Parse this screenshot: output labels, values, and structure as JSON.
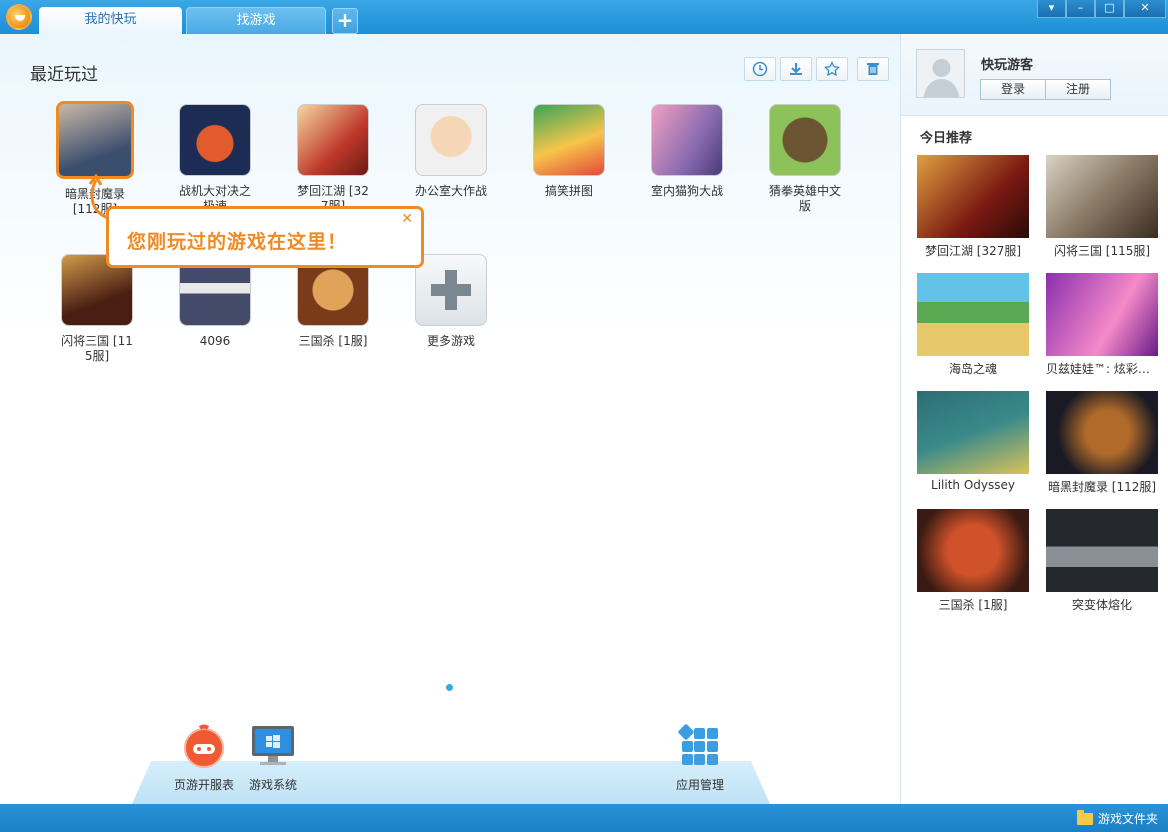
{
  "titlebar": {
    "tabs": [
      {
        "label": "我的快玩",
        "active": true
      },
      {
        "label": "找游戏",
        "active": false
      }
    ],
    "add_label": "+",
    "window_buttons": [
      "▾",
      "–",
      "□",
      "✕"
    ]
  },
  "main": {
    "section_title": "最近玩过",
    "toolbar": [
      "clock-icon",
      "download-icon",
      "star-icon",
      "trash-icon"
    ],
    "games": [
      {
        "label": "暗黑封魔录 [112服]",
        "color1": "#3a4e6e",
        "color2": "#c9b8a6",
        "selected": true
      },
      {
        "label": "战机大对决之极速",
        "color1": "#1d2c55",
        "color2": "#e25b2d"
      },
      {
        "label": "梦回江湖 [327服]",
        "color1": "#c0392b",
        "color2": "#f3d8a0"
      },
      {
        "label": "办公室大作战",
        "color1": "#f0f0f0",
        "color2": "#5d8f4b"
      },
      {
        "label": "搞笑拼图",
        "color1": "#f7c54a",
        "color2": "#3aa55a"
      },
      {
        "label": "室内猫狗大战",
        "color1": "#8a6bb1",
        "color2": "#f0a0c0"
      },
      {
        "label": "猜拳英雄中文版",
        "color1": "#8dc25a",
        "color2": "#6b5533"
      },
      {
        "label": "闪将三国 [115服]",
        "color1": "#4a1e12",
        "color2": "#d19b4b"
      },
      {
        "label": "4096",
        "color1": "#444a6a",
        "color2": "#e9e9e9"
      },
      {
        "label": "三国杀 [1服]",
        "color1": "#7a3b1a",
        "color2": "#e1a35a"
      },
      {
        "label": "更多游戏",
        "more": true
      }
    ],
    "tip": {
      "text": "您刚玩过的游戏在这里！",
      "close": "✕"
    },
    "dock": [
      {
        "label": "页游开服表"
      },
      {
        "label": "游戏系统"
      },
      {
        "label": "应用管理"
      }
    ]
  },
  "panel": {
    "username": "快玩游客",
    "login_label": "登录",
    "register_label": "注册",
    "rec_title": "今日推荐",
    "recommendations": [
      {
        "label": "梦回江湖 [327服]",
        "c1": "#7b1a12",
        "c2": "#e0a040"
      },
      {
        "label": "闪将三国 [115服]",
        "c1": "#d9d2c4",
        "c2": "#3b2d22"
      },
      {
        "label": "海岛之魂",
        "c1": "#63c2e8",
        "c2": "#e6c86a"
      },
      {
        "label": "贝兹娃娃™: 炫彩时尚",
        "c1": "#8a2fb0",
        "c2": "#f58ac8"
      },
      {
        "label": "Lilith Odyssey",
        "c1": "#2d6e74",
        "c2": "#d9c35a"
      },
      {
        "label": "暗黑封魔录 [112服]",
        "c1": "#1a1a24",
        "c2": "#b06a2a"
      },
      {
        "label": "三国杀 [1服]",
        "c1": "#3a1a12",
        "c2": "#d0522a"
      },
      {
        "label": "突变体熔化",
        "c1": "#24282c",
        "c2": "#8a9096"
      }
    ]
  },
  "statusbar": {
    "folder_label": "游戏文件夹"
  }
}
